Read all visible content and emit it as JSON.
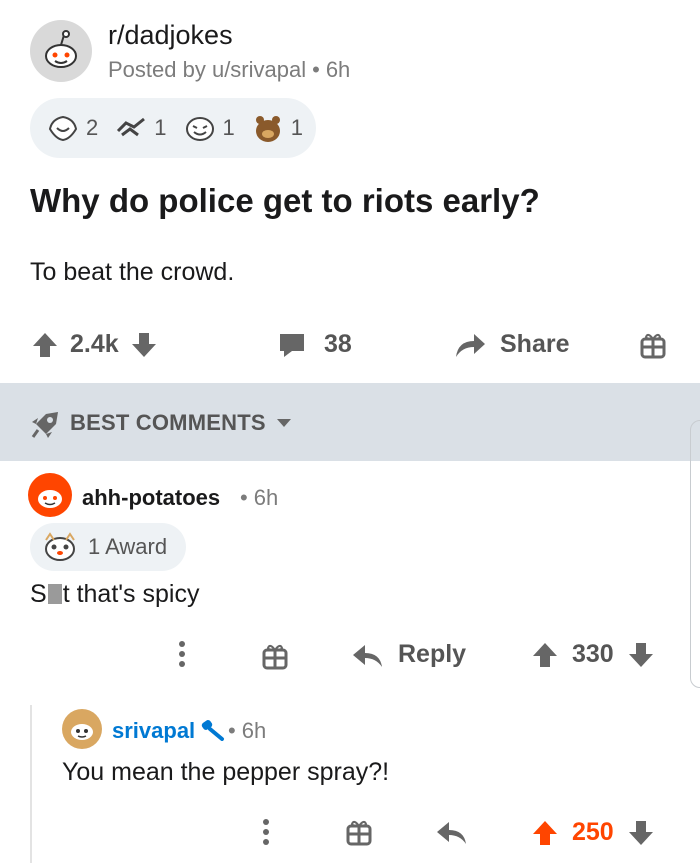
{
  "post": {
    "subreddit": "r/dadjokes",
    "posted_by": "Posted by u/srivapal",
    "time": "6h",
    "awards": [
      {
        "icon": "wholesome-award-icon",
        "count": "2"
      },
      {
        "icon": "handshake-award-icon",
        "count": "1"
      },
      {
        "icon": "laughing-face-award-icon",
        "count": "1"
      },
      {
        "icon": "bear-award-icon",
        "count": "1"
      }
    ],
    "title": "Why do police get to riots early?",
    "body": "To beat the crowd.",
    "score": "2.4k",
    "comments_count": "38",
    "share_label": "Share"
  },
  "sort": {
    "label": "BEST COMMENTS"
  },
  "comment": {
    "username": "ahh-potatoes",
    "time": "6h",
    "award_label": "1 Award",
    "text_prefix": "S",
    "text_suffix": "t that's spicy",
    "reply_label": "Reply",
    "score": "330"
  },
  "reply": {
    "username": "srivapal",
    "time": "6h",
    "text": "You mean the pepper spray?!",
    "score": "250"
  },
  "colors": {
    "upvote_orange": "#ff4500",
    "op_blue": "#0079d3",
    "band_grey": "#dae0e6",
    "pill_grey": "#eef2f5"
  }
}
